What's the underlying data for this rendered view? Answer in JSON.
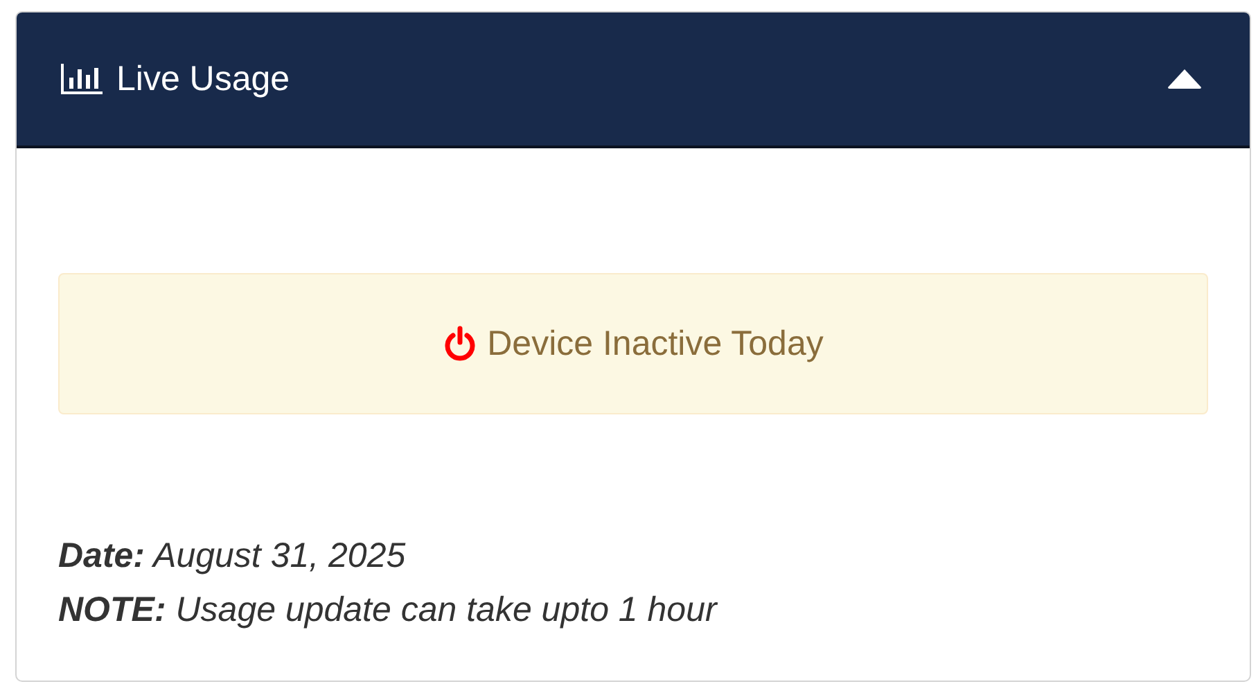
{
  "panel": {
    "title": "Live Usage",
    "expanded": true
  },
  "alert": {
    "text": "Device Inactive Today"
  },
  "notes": [
    {
      "label": "Date:",
      "text": "August 31, 2025"
    },
    {
      "label": "NOTE:",
      "text": "Usage update can take upto 1 hour"
    }
  ]
}
